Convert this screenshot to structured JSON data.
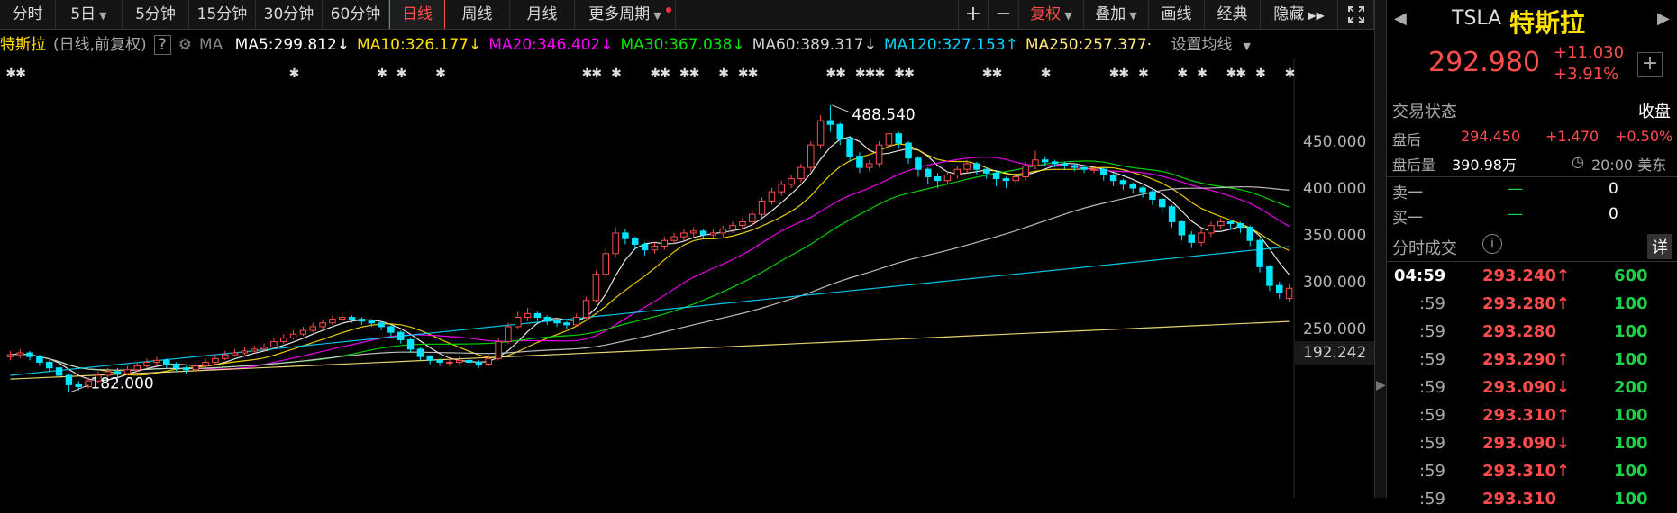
{
  "toolbar": {
    "periods": [
      "分时",
      "5日",
      "5分钟",
      "15分钟",
      "30分钟",
      "60分钟",
      "日线",
      "周线",
      "月线",
      "更多周期"
    ],
    "active_period": "日线",
    "zoom_in": "+",
    "zoom_out": "−",
    "adjust_label": "复权",
    "overlay_label": "叠加",
    "draw_label": "画线",
    "classic_label": "经典",
    "hide_label": "隐藏",
    "expand_icon": "expand-icon"
  },
  "ma_bar": {
    "stock_name": "特斯拉",
    "period_note": "(日线,前复权)",
    "help": "?",
    "ma_label": "MA",
    "items": [
      {
        "label": "MA5:299.812",
        "arrow": "↓",
        "color": "#ffffff"
      },
      {
        "label": "MA10:326.177",
        "arrow": "↓",
        "color": "#ffe100"
      },
      {
        "label": "MA20:346.402",
        "arrow": "↓",
        "color": "#ff00ff"
      },
      {
        "label": "MA30:367.038",
        "arrow": "↓",
        "color": "#00e600"
      },
      {
        "label": "MA60:389.317",
        "arrow": "↓",
        "color": "#d0d0d0"
      },
      {
        "label": "MA120:327.153",
        "arrow": "↑",
        "color": "#00d8ff"
      },
      {
        "label": "MA250:257.377",
        "arrow": "·",
        "color": "#ffeb7a"
      }
    ],
    "settings_label": "设置均线"
  },
  "chart_data": {
    "type": "candlestick",
    "y_ticks": [
      "450.000",
      "400.000",
      "350.000",
      "300.000",
      "250.000"
    ],
    "current_low_label": "192.242",
    "high_annotation": "488.540",
    "low_annotation": "182.000",
    "ylim": [
      192.242,
      500
    ],
    "closes": [
      222,
      224,
      220,
      214,
      208,
      200,
      190,
      188,
      194,
      200,
      204,
      202,
      206,
      210,
      214,
      216,
      212,
      208,
      206,
      210,
      214,
      218,
      222,
      224,
      226,
      228,
      230,
      236,
      240,
      244,
      248,
      252,
      256,
      260,
      262,
      260,
      258,
      256,
      252,
      246,
      238,
      228,
      220,
      216,
      214,
      214,
      216,
      214,
      212,
      218,
      236,
      252,
      262,
      266,
      262,
      258,
      256,
      254,
      262,
      280,
      308,
      330,
      352,
      346,
      340,
      334,
      338,
      344,
      348,
      352,
      354,
      350,
      352,
      356,
      360,
      364,
      372,
      386,
      396,
      404,
      410,
      422,
      446,
      472,
      468,
      452,
      434,
      422,
      426,
      446,
      458,
      448,
      432,
      420,
      412,
      408,
      414,
      420,
      426,
      420,
      416,
      410,
      408,
      412,
      424,
      430,
      428,
      426,
      424,
      422,
      420,
      420,
      414,
      408,
      404,
      400,
      396,
      388,
      380,
      364,
      350,
      342,
      352,
      360,
      364,
      362,
      358,
      344,
      316,
      296,
      288,
      293
    ],
    "candles": [
      {
        "o": 220,
        "c": 222,
        "h": 226,
        "l": 216
      },
      {
        "o": 222,
        "c": 224,
        "h": 228,
        "l": 218
      },
      {
        "o": 224,
        "c": 220,
        "h": 226,
        "l": 216
      },
      {
        "o": 220,
        "c": 214,
        "h": 222,
        "l": 210
      },
      {
        "o": 214,
        "c": 208,
        "h": 216,
        "l": 204
      },
      {
        "o": 208,
        "c": 200,
        "h": 210,
        "l": 194
      },
      {
        "o": 200,
        "c": 190,
        "h": 202,
        "l": 182
      },
      {
        "o": 190,
        "c": 188,
        "h": 194,
        "l": 184
      },
      {
        "o": 188,
        "c": 194,
        "h": 198,
        "l": 186
      },
      {
        "o": 194,
        "c": 200,
        "h": 204,
        "l": 192
      },
      {
        "o": 200,
        "c": 204,
        "h": 208,
        "l": 198
      },
      {
        "o": 204,
        "c": 202,
        "h": 208,
        "l": 198
      },
      {
        "o": 202,
        "c": 206,
        "h": 210,
        "l": 200
      },
      {
        "o": 206,
        "c": 210,
        "h": 214,
        "l": 204
      },
      {
        "o": 210,
        "c": 214,
        "h": 218,
        "l": 208
      },
      {
        "o": 214,
        "c": 216,
        "h": 220,
        "l": 210
      },
      {
        "o": 216,
        "c": 212,
        "h": 218,
        "l": 208
      },
      {
        "o": 212,
        "c": 208,
        "h": 214,
        "l": 204
      },
      {
        "o": 208,
        "c": 206,
        "h": 210,
        "l": 202
      },
      {
        "o": 206,
        "c": 210,
        "h": 214,
        "l": 204
      },
      {
        "o": 210,
        "c": 214,
        "h": 218,
        "l": 208
      },
      {
        "o": 214,
        "c": 218,
        "h": 222,
        "l": 212
      },
      {
        "o": 218,
        "c": 222,
        "h": 226,
        "l": 216
      },
      {
        "o": 222,
        "c": 224,
        "h": 228,
        "l": 220
      },
      {
        "o": 224,
        "c": 226,
        "h": 230,
        "l": 222
      },
      {
        "o": 226,
        "c": 228,
        "h": 232,
        "l": 224
      },
      {
        "o": 228,
        "c": 230,
        "h": 234,
        "l": 226
      },
      {
        "o": 230,
        "c": 236,
        "h": 240,
        "l": 228
      },
      {
        "o": 236,
        "c": 240,
        "h": 244,
        "l": 234
      },
      {
        "o": 240,
        "c": 244,
        "h": 248,
        "l": 238
      },
      {
        "o": 244,
        "c": 248,
        "h": 252,
        "l": 242
      },
      {
        "o": 248,
        "c": 252,
        "h": 256,
        "l": 246
      },
      {
        "o": 252,
        "c": 256,
        "h": 260,
        "l": 250
      },
      {
        "o": 256,
        "c": 260,
        "h": 264,
        "l": 254
      },
      {
        "o": 260,
        "c": 262,
        "h": 266,
        "l": 258
      },
      {
        "o": 262,
        "c": 260,
        "h": 264,
        "l": 256
      },
      {
        "o": 260,
        "c": 258,
        "h": 262,
        "l": 254
      },
      {
        "o": 258,
        "c": 256,
        "h": 260,
        "l": 252
      },
      {
        "o": 256,
        "c": 252,
        "h": 258,
        "l": 248
      },
      {
        "o": 252,
        "c": 246,
        "h": 254,
        "l": 242
      },
      {
        "o": 246,
        "c": 238,
        "h": 248,
        "l": 234
      },
      {
        "o": 238,
        "c": 228,
        "h": 240,
        "l": 224
      },
      {
        "o": 228,
        "c": 220,
        "h": 230,
        "l": 216
      },
      {
        "o": 220,
        "c": 216,
        "h": 222,
        "l": 212
      },
      {
        "o": 216,
        "c": 214,
        "h": 218,
        "l": 210
      },
      {
        "o": 214,
        "c": 214,
        "h": 218,
        "l": 210
      },
      {
        "o": 214,
        "c": 216,
        "h": 220,
        "l": 212
      },
      {
        "o": 216,
        "c": 214,
        "h": 218,
        "l": 210
      },
      {
        "o": 214,
        "c": 212,
        "h": 216,
        "l": 208
      },
      {
        "o": 212,
        "c": 218,
        "h": 222,
        "l": 210
      },
      {
        "o": 218,
        "c": 236,
        "h": 240,
        "l": 216
      },
      {
        "o": 236,
        "c": 252,
        "h": 256,
        "l": 234
      },
      {
        "o": 252,
        "c": 262,
        "h": 268,
        "l": 250
      },
      {
        "o": 262,
        "c": 266,
        "h": 272,
        "l": 258
      },
      {
        "o": 266,
        "c": 262,
        "h": 268,
        "l": 258
      },
      {
        "o": 262,
        "c": 258,
        "h": 264,
        "l": 254
      },
      {
        "o": 258,
        "c": 256,
        "h": 260,
        "l": 252
      },
      {
        "o": 256,
        "c": 254,
        "h": 258,
        "l": 250
      },
      {
        "o": 254,
        "c": 262,
        "h": 266,
        "l": 252
      },
      {
        "o": 262,
        "c": 280,
        "h": 284,
        "l": 260
      },
      {
        "o": 280,
        "c": 308,
        "h": 312,
        "l": 278
      },
      {
        "o": 308,
        "c": 330,
        "h": 336,
        "l": 304
      },
      {
        "o": 330,
        "c": 352,
        "h": 358,
        "l": 326
      },
      {
        "o": 352,
        "c": 346,
        "h": 356,
        "l": 340
      },
      {
        "o": 346,
        "c": 340,
        "h": 348,
        "l": 334
      },
      {
        "o": 340,
        "c": 334,
        "h": 342,
        "l": 328
      },
      {
        "o": 334,
        "c": 338,
        "h": 342,
        "l": 330
      },
      {
        "o": 338,
        "c": 344,
        "h": 348,
        "l": 334
      },
      {
        "o": 344,
        "c": 348,
        "h": 352,
        "l": 340
      },
      {
        "o": 348,
        "c": 352,
        "h": 356,
        "l": 344
      },
      {
        "o": 352,
        "c": 354,
        "h": 358,
        "l": 348
      },
      {
        "o": 354,
        "c": 350,
        "h": 356,
        "l": 346
      },
      {
        "o": 350,
        "c": 352,
        "h": 356,
        "l": 346
      },
      {
        "o": 352,
        "c": 356,
        "h": 360,
        "l": 348
      },
      {
        "o": 356,
        "c": 360,
        "h": 364,
        "l": 352
      },
      {
        "o": 360,
        "c": 364,
        "h": 368,
        "l": 356
      },
      {
        "o": 364,
        "c": 372,
        "h": 376,
        "l": 360
      },
      {
        "o": 372,
        "c": 386,
        "h": 390,
        "l": 368
      },
      {
        "o": 386,
        "c": 396,
        "h": 400,
        "l": 382
      },
      {
        "o": 396,
        "c": 404,
        "h": 408,
        "l": 392
      },
      {
        "o": 404,
        "c": 410,
        "h": 414,
        "l": 400
      },
      {
        "o": 410,
        "c": 422,
        "h": 426,
        "l": 406
      },
      {
        "o": 422,
        "c": 446,
        "h": 450,
        "l": 418
      },
      {
        "o": 446,
        "c": 472,
        "h": 478,
        "l": 442
      },
      {
        "o": 472,
        "c": 468,
        "h": 488.54,
        "l": 460
      },
      {
        "o": 468,
        "c": 452,
        "h": 470,
        "l": 446
      },
      {
        "o": 452,
        "c": 434,
        "h": 456,
        "l": 428
      },
      {
        "o": 434,
        "c": 422,
        "h": 438,
        "l": 416
      },
      {
        "o": 422,
        "c": 426,
        "h": 430,
        "l": 418
      },
      {
        "o": 426,
        "c": 446,
        "h": 450,
        "l": 422
      },
      {
        "o": 446,
        "c": 458,
        "h": 462,
        "l": 440
      },
      {
        "o": 458,
        "c": 448,
        "h": 460,
        "l": 442
      },
      {
        "o": 448,
        "c": 432,
        "h": 450,
        "l": 426
      },
      {
        "o": 432,
        "c": 420,
        "h": 434,
        "l": 412
      },
      {
        "o": 420,
        "c": 412,
        "h": 422,
        "l": 404
      },
      {
        "o": 412,
        "c": 408,
        "h": 416,
        "l": 400
      },
      {
        "o": 408,
        "c": 414,
        "h": 418,
        "l": 404
      },
      {
        "o": 414,
        "c": 420,
        "h": 424,
        "l": 410
      },
      {
        "o": 420,
        "c": 426,
        "h": 430,
        "l": 416
      },
      {
        "o": 426,
        "c": 420,
        "h": 428,
        "l": 414
      },
      {
        "o": 420,
        "c": 416,
        "h": 422,
        "l": 410
      },
      {
        "o": 416,
        "c": 410,
        "h": 418,
        "l": 402
      },
      {
        "o": 410,
        "c": 408,
        "h": 412,
        "l": 400
      },
      {
        "o": 408,
        "c": 412,
        "h": 416,
        "l": 404
      },
      {
        "o": 412,
        "c": 424,
        "h": 428,
        "l": 408
      },
      {
        "o": 424,
        "c": 430,
        "h": 440,
        "l": 420
      },
      {
        "o": 430,
        "c": 428,
        "h": 434,
        "l": 424
      },
      {
        "o": 428,
        "c": 426,
        "h": 430,
        "l": 422
      },
      {
        "o": 426,
        "c": 424,
        "h": 428,
        "l": 420
      },
      {
        "o": 424,
        "c": 422,
        "h": 426,
        "l": 418
      },
      {
        "o": 422,
        "c": 420,
        "h": 424,
        "l": 416
      },
      {
        "o": 420,
        "c": 420,
        "h": 424,
        "l": 416
      },
      {
        "o": 420,
        "c": 414,
        "h": 422,
        "l": 408
      },
      {
        "o": 414,
        "c": 408,
        "h": 416,
        "l": 402
      },
      {
        "o": 408,
        "c": 404,
        "h": 410,
        "l": 398
      },
      {
        "o": 404,
        "c": 400,
        "h": 406,
        "l": 394
      },
      {
        "o": 400,
        "c": 396,
        "h": 402,
        "l": 390
      },
      {
        "o": 396,
        "c": 388,
        "h": 398,
        "l": 382
      },
      {
        "o": 388,
        "c": 380,
        "h": 390,
        "l": 374
      },
      {
        "o": 380,
        "c": 364,
        "h": 382,
        "l": 358
      },
      {
        "o": 364,
        "c": 350,
        "h": 366,
        "l": 344
      },
      {
        "o": 350,
        "c": 342,
        "h": 354,
        "l": 336
      },
      {
        "o": 342,
        "c": 352,
        "h": 356,
        "l": 338
      },
      {
        "o": 352,
        "c": 360,
        "h": 364,
        "l": 348
      },
      {
        "o": 360,
        "c": 364,
        "h": 368,
        "l": 356
      },
      {
        "o": 364,
        "c": 362,
        "h": 366,
        "l": 356
      },
      {
        "o": 362,
        "c": 358,
        "h": 364,
        "l": 352
      },
      {
        "o": 358,
        "c": 344,
        "h": 360,
        "l": 338
      },
      {
        "o": 344,
        "c": 316,
        "h": 346,
        "l": 310
      },
      {
        "o": 316,
        "c": 296,
        "h": 318,
        "l": 290
      },
      {
        "o": 296,
        "c": 288,
        "h": 300,
        "l": 282
      },
      {
        "o": 282,
        "c": 293,
        "h": 298,
        "l": 278
      }
    ]
  },
  "quote": {
    "symbol": "TSLA",
    "name": "特斯拉",
    "price": "292.980",
    "change": "+11.030",
    "change_pct": "+3.91%",
    "add_icon": "plus-icon"
  },
  "trade_state": {
    "label": "交易状态",
    "value": "收盘"
  },
  "after_hours": {
    "label": "盘后",
    "price": "294.450",
    "change": "+1.470",
    "change_pct": "+0.50%",
    "volume_label": "盘后量",
    "volume": "390.98万",
    "time": "20:00 美东"
  },
  "order_book": [
    {
      "label": "卖一",
      "price": "—",
      "qty": "0"
    },
    {
      "label": "买一",
      "price": "—",
      "qty": "0"
    }
  ],
  "ticks": {
    "title": "分时成交",
    "detail_label": "详",
    "rows": [
      {
        "time": "04:59",
        "price": "293.240",
        "dir": "↑",
        "vol": "600"
      },
      {
        "time": ":59",
        "price": "293.280",
        "dir": "↑",
        "vol": "100"
      },
      {
        "time": ":59",
        "price": "293.280",
        "dir": "",
        "vol": "100"
      },
      {
        "time": ":59",
        "price": "293.290",
        "dir": "↑",
        "vol": "100"
      },
      {
        "time": ":59",
        "price": "293.090",
        "dir": "↓",
        "vol": "200"
      },
      {
        "time": ":59",
        "price": "293.310",
        "dir": "↑",
        "vol": "100"
      },
      {
        "time": ":59",
        "price": "293.090",
        "dir": "↓",
        "vol": "100"
      },
      {
        "time": ":59",
        "price": "293.310",
        "dir": "↑",
        "vol": "100"
      },
      {
        "time": ":59",
        "price": "293.310",
        "dir": "",
        "vol": "100"
      }
    ]
  }
}
